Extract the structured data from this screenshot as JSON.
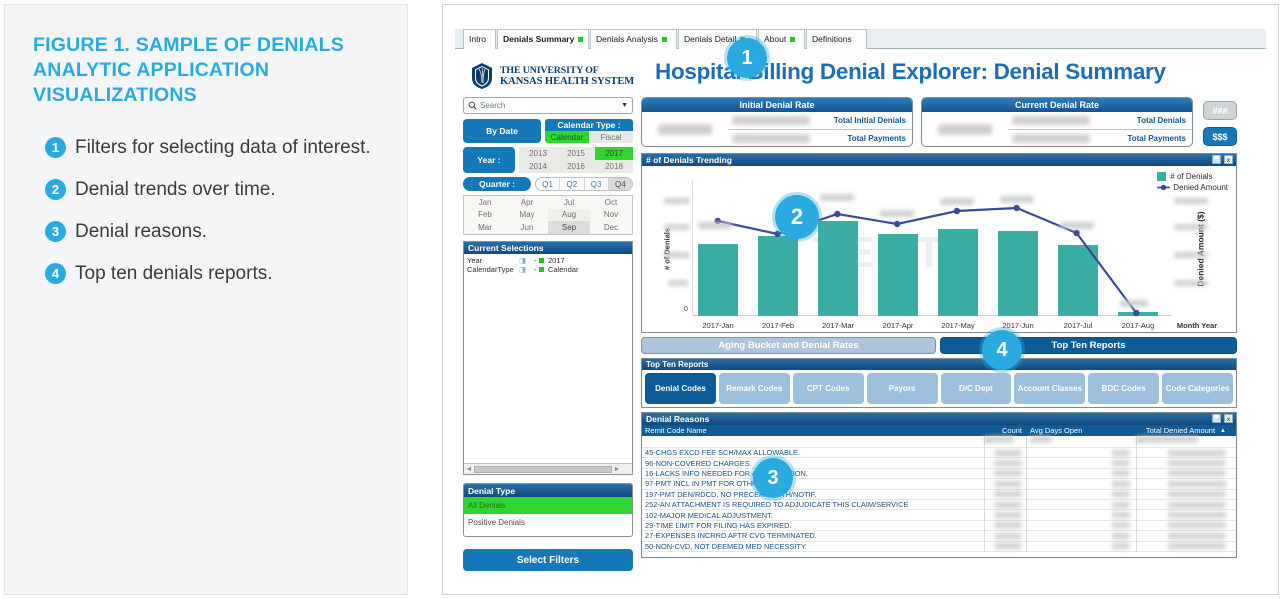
{
  "caption": {
    "title": "FIGURE 1. SAMPLE OF DENIALS ANALYTIC APPLICATION VISUALIZATIONS",
    "items": [
      {
        "num": "1",
        "text": "Filters for selecting data of interest."
      },
      {
        "num": "2",
        "text": "Denial trends over time."
      },
      {
        "num": "3",
        "text": "Denial reasons."
      },
      {
        "num": "4",
        "text": "Top ten denials reports."
      }
    ],
    "accent_color": "#29ABE2"
  },
  "app": {
    "tabs": [
      {
        "label": "Intro",
        "has_dot": false,
        "active": false
      },
      {
        "label": "Denials Summary",
        "has_dot": true,
        "active": true
      },
      {
        "label": "Denials Analysis",
        "has_dot": true,
        "active": false
      },
      {
        "label": "Denials Detail",
        "has_dot": true,
        "active": false
      },
      {
        "label": "About",
        "has_dot": true,
        "active": false
      },
      {
        "label": "Definitions",
        "has_dot": false,
        "active": false
      }
    ],
    "logo": {
      "line1": "THE UNIVERSITY OF",
      "line2": "KANSAS HEALTH SYSTEM"
    },
    "title": "Hospital Billing Denial Explorer: Denial Summary",
    "title_color": "#1b6db5"
  },
  "filters": {
    "search_placeholder": "Search",
    "by_date_label": "By Date",
    "calendar_type": {
      "label": "Calendar Type :",
      "options": [
        {
          "label": "Calendar",
          "selected": true
        },
        {
          "label": "Fiscal",
          "selected": false
        }
      ]
    },
    "year": {
      "label": "Year :",
      "options": [
        {
          "label": "2013",
          "selected": false
        },
        {
          "label": "2015",
          "selected": false
        },
        {
          "label": "2017",
          "selected": true
        },
        {
          "label": "2014",
          "selected": false
        },
        {
          "label": "2016",
          "selected": false
        },
        {
          "label": "2018",
          "selected": false
        }
      ]
    },
    "quarter": {
      "label": "Quarter :",
      "options": [
        {
          "label": "Q1",
          "state": "normal"
        },
        {
          "label": "Q2",
          "state": "normal"
        },
        {
          "label": "Q3",
          "state": "normal"
        },
        {
          "label": "Q4",
          "state": "dim"
        }
      ]
    },
    "months": [
      {
        "label": "Jan",
        "state": "normal"
      },
      {
        "label": "Apr",
        "state": "normal"
      },
      {
        "label": "Jul",
        "state": "normal"
      },
      {
        "label": "Oct",
        "state": "normal"
      },
      {
        "label": "Feb",
        "state": "normal"
      },
      {
        "label": "May",
        "state": "normal"
      },
      {
        "label": "Aug",
        "state": "lite"
      },
      {
        "label": "Nov",
        "state": "normal"
      },
      {
        "label": "Mar",
        "state": "normal"
      },
      {
        "label": "Jun",
        "state": "normal"
      },
      {
        "label": "Sep",
        "state": "dim"
      },
      {
        "label": "Dec",
        "state": "normal"
      }
    ],
    "current_selections": {
      "title": "Current Selections",
      "rows": [
        {
          "field": "Year",
          "separator": "-",
          "value": "2017"
        },
        {
          "field": "CalendarType",
          "separator": "-",
          "value": "Calendar"
        }
      ]
    },
    "denial_type": {
      "title": "Denial Type",
      "options": [
        {
          "label": "All Denials",
          "selected": true
        },
        {
          "label": "Positive Denials",
          "selected": false
        }
      ]
    },
    "select_filters_label": "Select Filters"
  },
  "kpis": [
    {
      "title": "Initial Denial Rate",
      "rows": [
        {
          "label": "Total Initial Denials"
        },
        {
          "label": "Total Payments"
        }
      ]
    },
    {
      "title": "Current Denial Rate",
      "rows": [
        {
          "label": "Total Denials"
        },
        {
          "label": "Total Payments"
        }
      ]
    }
  ],
  "side_buttons": [
    {
      "label": "###",
      "active": false
    },
    {
      "label": "$$$",
      "active": true
    }
  ],
  "chart_data": {
    "type": "bar",
    "title": "# of Denials Trending",
    "xlabel": "Month Year",
    "ylabel": "# of Denials",
    "y2label": "Denied Amount ($)",
    "grid": false,
    "legend_position": "top-right",
    "categories": [
      "2017-Jan",
      "2017-Feb",
      "2017-Mar",
      "2017-Apr",
      "2017-May",
      "2017-Jun",
      "2017-Jul",
      "2017-Aug"
    ],
    "series": [
      {
        "name": "# of Denials",
        "type": "bar",
        "color": "#3aada4",
        "axis": "left",
        "values": [
          7400,
          8000,
          9200,
          8100,
          8600,
          8400,
          7300,
          180
        ]
      },
      {
        "name": "Denied Amount",
        "type": "line",
        "color": "#3b4a99",
        "axis": "right",
        "values": [
          49000000,
          45000000,
          52000000,
          48000000,
          53000000,
          54000000,
          43000000,
          4000000
        ]
      }
    ],
    "ylim": [
      0,
      10000
    ],
    "y2lim": [
      0,
      60000000
    ],
    "values_redacted": true,
    "watermark": "TEST"
  },
  "sections": {
    "aging_label": "Aging Bucket and Denial Rates",
    "topten_label": "Top Ten Reports"
  },
  "top_ten_reports": {
    "title": "Top Ten Reports",
    "tabs": [
      {
        "label": "Denial Codes",
        "active": true
      },
      {
        "label": "Remark Codes",
        "active": false
      },
      {
        "label": "CPT Codes",
        "active": false
      },
      {
        "label": "Payors",
        "active": false
      },
      {
        "label": "D/C Dept",
        "active": false
      },
      {
        "label": "Account Classes",
        "active": false
      },
      {
        "label": "BDC Codes",
        "active": false
      },
      {
        "label": "Code Categories",
        "active": false
      }
    ]
  },
  "denial_reasons": {
    "title": "Denial Reasons",
    "columns": [
      "Remit Code Name",
      "Count",
      "Avg Days Open",
      "Total Denied Amount"
    ],
    "sort_indicator": "▲",
    "rows": [
      {
        "remit": "45-CHGS EXCD FEE SCH/MAX ALLOWABLE."
      },
      {
        "remit": "96-NON-COVERED CHARGES."
      },
      {
        "remit": "16-LACKS INFO NEEDED FOR ADJUDICATION."
      },
      {
        "remit": "97-PMT INCL IN PMT FOR OTHR SVC/RX."
      },
      {
        "remit": "197-PMT DEN/RDCD, NO PRECERT/AUTH/NOTIF."
      },
      {
        "remit": "252-AN ATTACHMENT IS REQUIRED TO ADJUDICATE THIS CLAIM/SERVICE"
      },
      {
        "remit": "102-MAJOR MEDICAL ADJUSTMENT."
      },
      {
        "remit": "29-TIME LIMIT FOR FILING HAS EXPIRED."
      },
      {
        "remit": "27-EXPENSES INCRRD AFTR CVG TERMINATED."
      },
      {
        "remit": "50-NON-CVD, NOT DEEMED MED NECESSITY."
      }
    ],
    "values_redacted": true
  },
  "callouts": [
    {
      "num": "1"
    },
    {
      "num": "2"
    },
    {
      "num": "3"
    },
    {
      "num": "4"
    }
  ]
}
